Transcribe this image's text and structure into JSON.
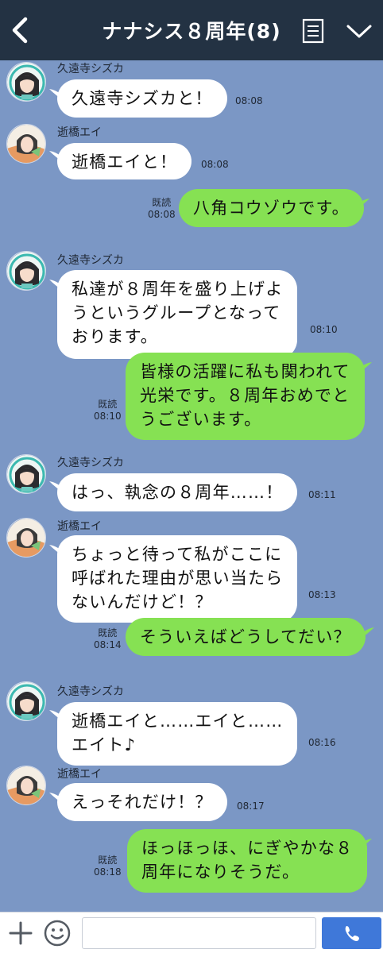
{
  "header": {
    "title": "ナナシス８周年(8)",
    "back_icon": "chevron-left-icon",
    "menu_icon": "note-list-icon",
    "down_icon": "chevron-down-icon"
  },
  "messages": [
    {
      "side": "left",
      "sender": "久遠寺シズカ",
      "lines": [
        "久遠寺シズカと！"
      ],
      "time": "08:08"
    },
    {
      "side": "left",
      "sender": "逝橋エイ",
      "lines": [
        "逝橋エイと！"
      ],
      "time": "08:08"
    },
    {
      "side": "right",
      "read": "既読",
      "lines": [
        "八角コウゾウです。"
      ],
      "time": "08:08"
    },
    {
      "side": "left",
      "sender": "久遠寺シズカ",
      "lines": [
        "私達が８周年を盛り上げよ",
        "うというグループとなって",
        "おります。"
      ],
      "time": "08:10"
    },
    {
      "side": "right",
      "read": "既読",
      "lines": [
        "皆様の活躍に私も関われて",
        "光栄です。８周年おめでと",
        "うございます。"
      ],
      "time": "08:10"
    },
    {
      "side": "left",
      "sender": "久遠寺シズカ",
      "lines": [
        "はっ、執念の８周年……！"
      ],
      "time": "08:11"
    },
    {
      "side": "left",
      "sender": "逝橋エイ",
      "lines": [
        "ちょっと待って私がここに",
        "呼ばれた理由が思い当たら",
        "ないんだけど！？"
      ],
      "time": "08:13"
    },
    {
      "side": "right",
      "read": "既読",
      "lines": [
        "そういえばどうしてだい？"
      ],
      "time": "08:14"
    },
    {
      "side": "left",
      "sender": "久遠寺シズカ",
      "lines": [
        "逝橋エイと……エイと……",
        "エイト♪"
      ],
      "time": "08:16"
    },
    {
      "side": "left",
      "sender": "逝橋エイ",
      "lines": [
        "えっそれだけ！？"
      ],
      "time": "08:17"
    },
    {
      "side": "right",
      "read": "既読",
      "lines": [
        "ほっほっほ、にぎやかな８",
        "周年になりそうだ。"
      ],
      "time": "08:18"
    }
  ],
  "inputbar": {
    "plus_icon": "plus-icon",
    "emoji_icon": "smiley-icon",
    "input_value": "",
    "send_icon": "phone-call-icon"
  },
  "colors": {
    "header_bg": "#233243",
    "chat_bg": "#7b97c5",
    "bubble_self": "#86e153",
    "bubble_other": "#ffffff",
    "call_button": "#3f78d9"
  }
}
